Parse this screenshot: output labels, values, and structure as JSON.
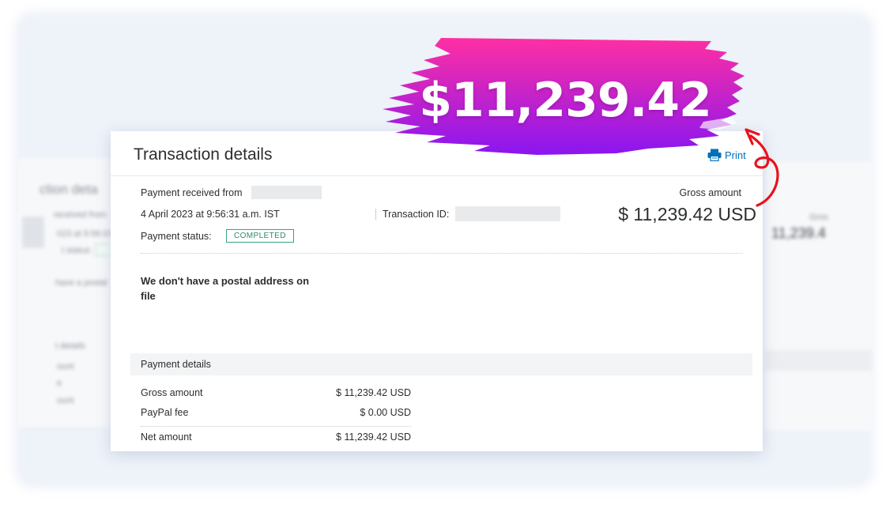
{
  "promo": {
    "amount": "$11,239.42"
  },
  "header": {
    "title": "Transaction details",
    "print_label": "Print"
  },
  "transaction": {
    "received_from_label": "Payment received from",
    "datetime": "4 April 2023 at 9:56:31 a.m. IST",
    "transaction_id_label": "Transaction ID:",
    "status_label": "Payment status:",
    "status_value": "COMPLETED",
    "gross_amount_label": "Gross amount",
    "gross_amount_value": "$ 11,239.42 USD",
    "postal_note": "We don't have a postal address on file"
  },
  "payment_details": {
    "title": "Payment details",
    "rows": [
      {
        "label": "Gross amount",
        "value": "$ 11,239.42 USD"
      },
      {
        "label": "PayPal fee",
        "value": "$ 0.00 USD"
      },
      {
        "label": "Net amount",
        "value": "$ 11,239.42 USD"
      }
    ]
  },
  "background_left": {
    "title_fragment": "ction deta",
    "line1": "received from",
    "line2": "023 at 9:56:31 a",
    "line3": "t status:",
    "postal_fragment": "have a postal",
    "details_fragment": "t details",
    "row1": "ount",
    "row2": "e",
    "row3": "ount"
  },
  "background_right": {
    "label_fragment": "Gros",
    "amount_fragment": "11,239.4"
  },
  "colors": {
    "brush_start": "#ff2fa3",
    "brush_end": "#8a16f0",
    "link": "#0070ba",
    "status_border": "#3aa57a",
    "arrow": "#e8121c"
  },
  "icons": {
    "print": "printer-icon",
    "arrow": "curved-arrow-icon"
  }
}
